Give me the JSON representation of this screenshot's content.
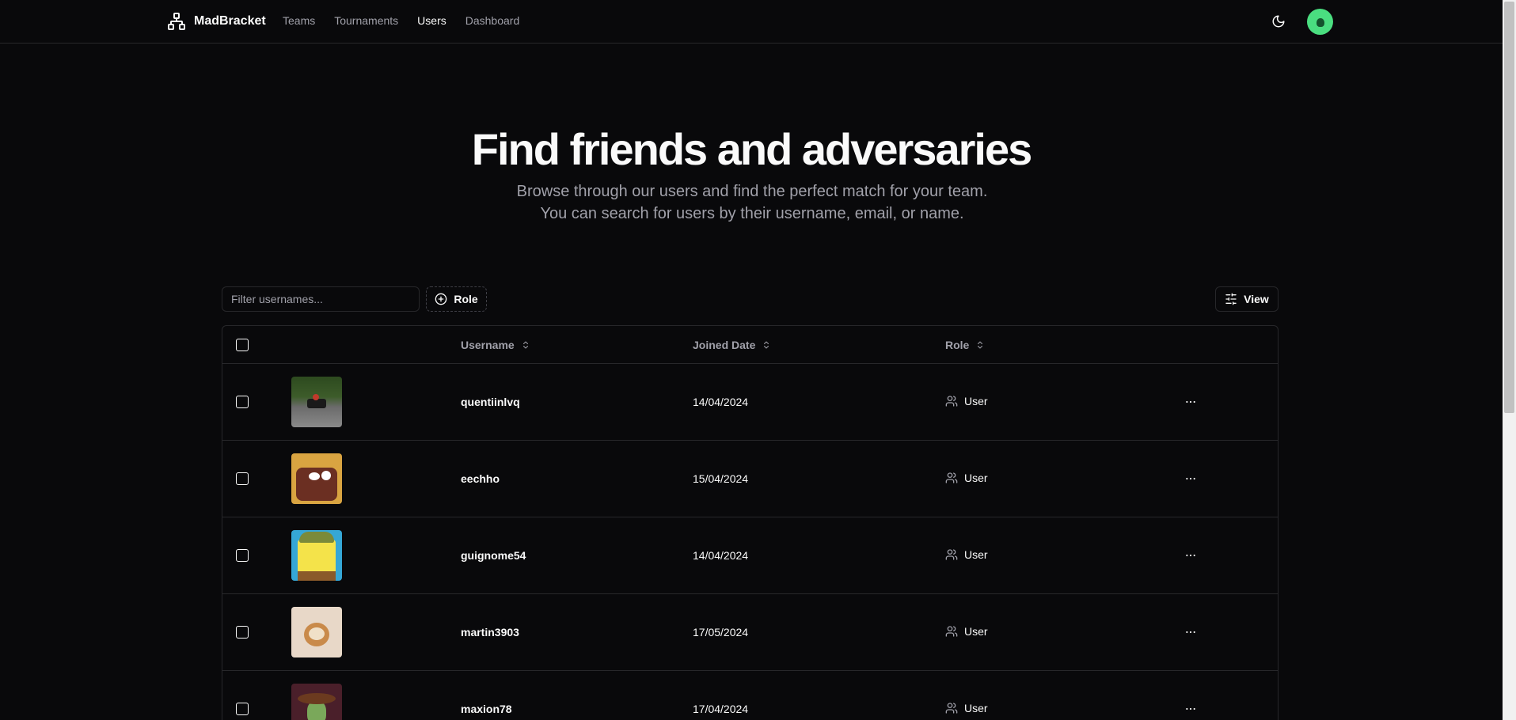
{
  "app": {
    "name": "MadBracket"
  },
  "nav": {
    "items": [
      {
        "label": "Teams",
        "active": false
      },
      {
        "label": "Tournaments",
        "active": false
      },
      {
        "label": "Users",
        "active": true
      },
      {
        "label": "Dashboard",
        "active": false
      }
    ]
  },
  "hero": {
    "title": "Find friends and adversaries",
    "subtitle": "Browse through our users and find the perfect match for your team. You can search for users by their username, email, or name."
  },
  "toolbar": {
    "filter_placeholder": "Filter usernames...",
    "filter_value": "",
    "role_label": "Role",
    "view_label": "View"
  },
  "table": {
    "columns": {
      "username": "Username",
      "joined": "Joined Date",
      "role": "Role"
    },
    "rows": [
      {
        "username": "quentiinlvq",
        "joined": "14/04/2024",
        "role": "User",
        "avatar": "kart"
      },
      {
        "username": "eechho",
        "joined": "15/04/2024",
        "role": "User",
        "avatar": "cookie"
      },
      {
        "username": "guignome54",
        "joined": "14/04/2024",
        "role": "User",
        "avatar": "sponge"
      },
      {
        "username": "martin3903",
        "joined": "17/05/2024",
        "role": "User",
        "avatar": "hamster"
      },
      {
        "username": "maxion78",
        "joined": "17/04/2024",
        "role": "User",
        "avatar": "cowboy"
      }
    ]
  },
  "colors": {
    "background": "#09090b",
    "border": "#27272a",
    "muted": "#a1a1aa",
    "avatar_green": "#4ade80"
  }
}
